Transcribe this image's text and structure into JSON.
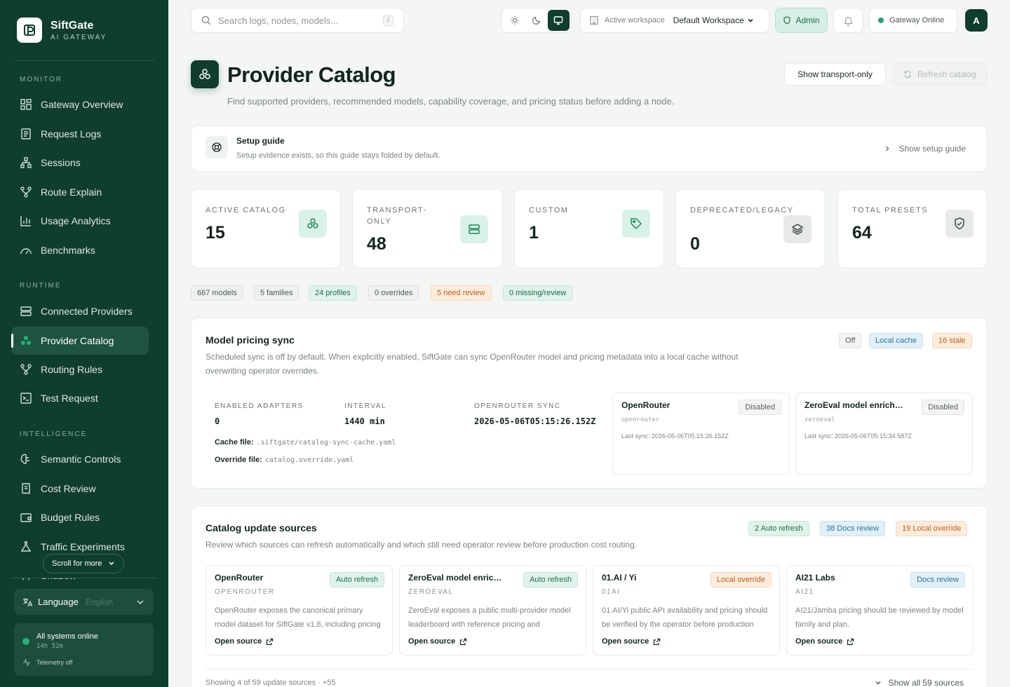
{
  "brand": {
    "name": "SiftGate",
    "subtitle": "AI GATEWAY"
  },
  "nav": {
    "monitor_label": "MONITOR",
    "runtime_label": "RUNTIME",
    "intelligence_label": "INTELLIGENCE",
    "items": [
      {
        "label": "Gateway Overview",
        "icon": "dashboard-icon"
      },
      {
        "label": "Request Logs",
        "icon": "logs-icon"
      },
      {
        "label": "Sessions",
        "icon": "sessions-icon"
      },
      {
        "label": "Route Explain",
        "icon": "route-icon"
      },
      {
        "label": "Usage Analytics",
        "icon": "chart-icon"
      },
      {
        "label": "Benchmarks",
        "icon": "gauge-icon"
      },
      {
        "label": "Connected Providers",
        "icon": "server-icon"
      },
      {
        "label": "Provider Catalog",
        "icon": "catalog-icon",
        "active": true
      },
      {
        "label": "Routing Rules",
        "icon": "route-icon"
      },
      {
        "label": "Test Request",
        "icon": "terminal-icon"
      },
      {
        "label": "Semantic Controls",
        "icon": "brain-icon"
      },
      {
        "label": "Cost Review",
        "icon": "receipt-icon"
      },
      {
        "label": "Budget Rules",
        "icon": "wallet-icon"
      },
      {
        "label": "Traffic Experiments",
        "icon": "flask-icon"
      },
      {
        "label": "Shadow",
        "icon": "shadow-icon"
      }
    ],
    "scroll_more": "Scroll for more"
  },
  "language": {
    "label": "Language",
    "value": "English"
  },
  "system_status": {
    "title": "All systems online",
    "uptime": "14h 52m",
    "telemetry": "Telemetry off"
  },
  "topbar": {
    "search_placeholder": "Search logs, nodes, models...",
    "search_shortcut": "/",
    "workspace_label": "Active workspace",
    "workspace_value": "Default Workspace",
    "role": "Admin",
    "gateway_status": "Gateway Online",
    "avatar_initial": "A"
  },
  "page": {
    "title": "Provider Catalog",
    "description": "Find supported providers, recommended models, capability coverage, and pricing status before adding a node.",
    "btn_transport": "Show transport-only",
    "btn_refresh": "Refresh catalog"
  },
  "guide": {
    "title": "Setup guide",
    "description": "Setup evidence exists, so this guide stays folded by default.",
    "toggle": "Show setup guide"
  },
  "stats": [
    {
      "label": "ACTIVE CATALOG",
      "value": "15"
    },
    {
      "label": "TRANSPORT-ONLY",
      "value": "48"
    },
    {
      "label": "CUSTOM",
      "value": "1"
    },
    {
      "label": "DEPRECATED/LEGACY",
      "value": "0"
    },
    {
      "label": "TOTAL PRESETS",
      "value": "64"
    }
  ],
  "chips": [
    "667 models",
    "5 families",
    "24 profiles",
    "0 overrides",
    "5 need review",
    "0 missing/review"
  ],
  "pricing_sync": {
    "title": "Model pricing sync",
    "description": "Scheduled sync is off by default. When explicitly enabled, SiftGate can sync OpenRouter model and pricing metadata into a local cache without overwriting operator overrides.",
    "badges": [
      "Off",
      "Local cache",
      "16 stale"
    ],
    "enabled_adapters_label": "ENABLED ADAPTERS",
    "enabled_adapters": "0",
    "interval_label": "INTERVAL",
    "interval": "1440 min",
    "openrouter_sync_label": "OPENROUTER SYNC",
    "openrouter_sync": "2026-05-06T05:15:26.152Z",
    "cache_file_label": "Cache file:",
    "cache_file": ".siftgate/catalog-sync-cache.yaml",
    "override_file_label": "Override file:",
    "override_file": "catalog.override.yaml",
    "adapters": [
      {
        "name": "OpenRouter",
        "id": "openrouter",
        "status": "Disabled",
        "last_sync": "Last sync: 2026-05-06T05:15:26.152Z"
      },
      {
        "name": "ZeroEval model enrichment",
        "id": "zeroeval",
        "status": "Disabled",
        "last_sync": "Last sync: 2026-05-06T05:15:34.587Z"
      }
    ]
  },
  "sources": {
    "title": "Catalog update sources",
    "description": "Review which sources can refresh automatically and which still need operator review before production cost routing.",
    "badges": [
      "2 Auto refresh",
      "38 Docs review",
      "19 Local override"
    ],
    "items": [
      {
        "name": "OpenRouter",
        "id": "OPENROUTER",
        "badge": "Auto refresh",
        "desc": "OpenRouter exposes the canonical primary model dataset for SiftGate v1.8, including pricing and capability metadata.",
        "link": "Open source"
      },
      {
        "name": "ZeroEval model enrichment",
        "id": "ZEROEVAL",
        "badge": "Auto refresh",
        "desc": "ZeroEval exposes a public multi-provider model leaderboard with reference pricing and benchmark scores.",
        "link": "Open source"
      },
      {
        "name": "01.AI / Yi",
        "id": "01AI",
        "badge": "Local override",
        "desc": "01.AI/Yi public API availability and pricing should be verified by the operator before production routing.",
        "link": "Open source"
      },
      {
        "name": "AI21 Labs",
        "id": "AI21",
        "badge": "Docs review",
        "desc": "AI21/Jamba pricing should be reviewed by model family and plan.",
        "link": "Open source"
      }
    ],
    "footer": "Showing 4 of 59 update sources · +55",
    "show_all": "Show all 59 sources"
  }
}
